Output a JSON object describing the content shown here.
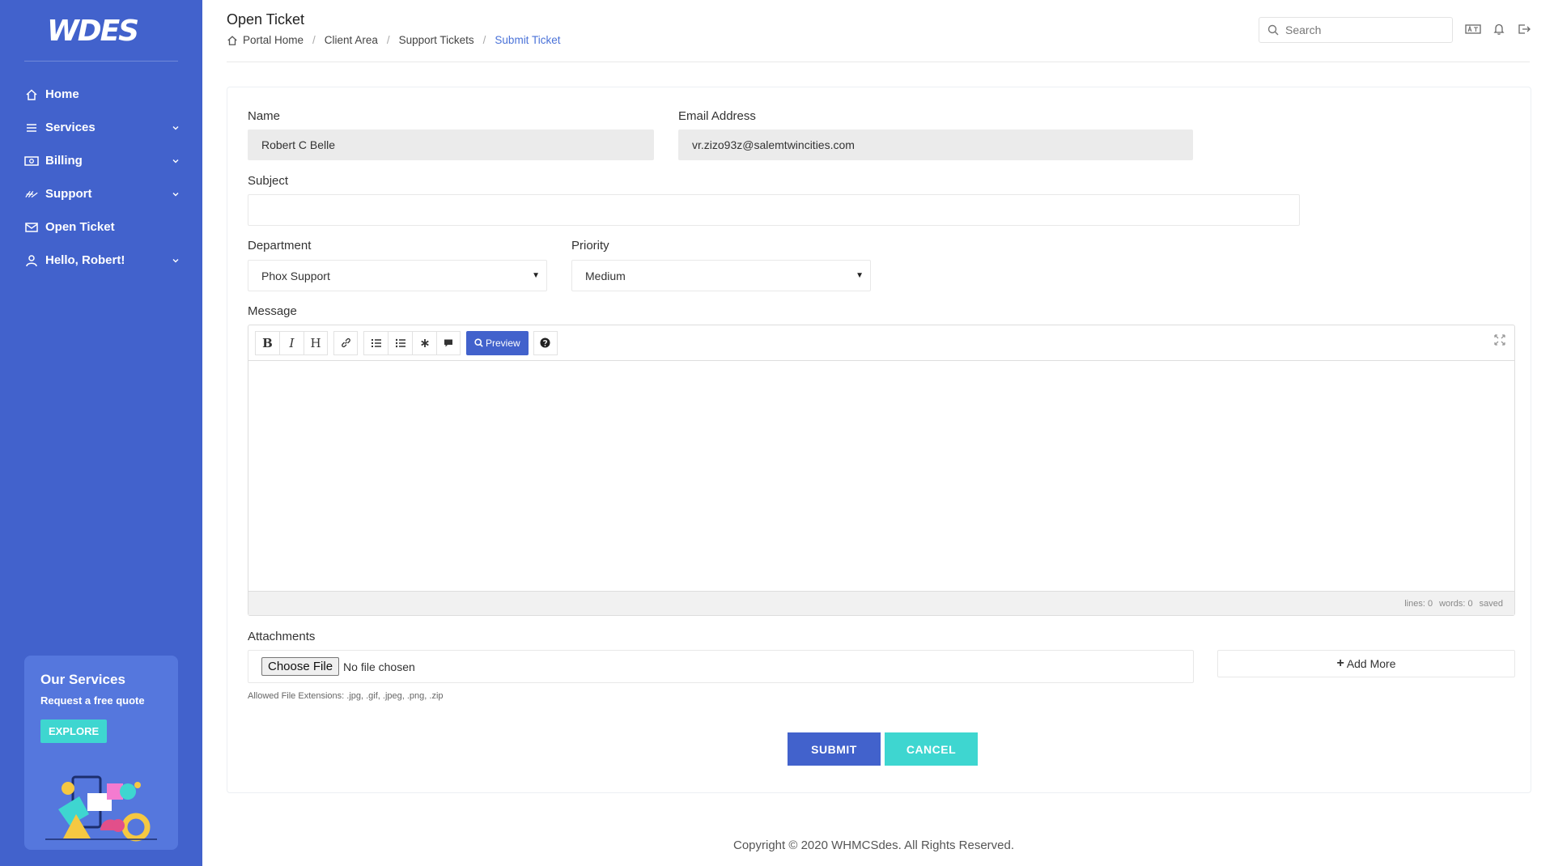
{
  "brand": {
    "logo_text": "WDES"
  },
  "sidebar": {
    "items": [
      {
        "label": "Home",
        "icon": "home-icon",
        "has_children": false
      },
      {
        "label": "Services",
        "icon": "menu-icon",
        "has_children": true
      },
      {
        "label": "Billing",
        "icon": "money-icon",
        "has_children": true
      },
      {
        "label": "Support",
        "icon": "support-icon",
        "has_children": true
      },
      {
        "label": "Open Ticket",
        "icon": "mail-icon",
        "has_children": false
      },
      {
        "label": "Hello, Robert!",
        "icon": "user-icon",
        "has_children": true
      }
    ],
    "promo": {
      "title": "Our Services",
      "subtitle": "Request a free quote",
      "button": "EXPLORE"
    }
  },
  "header": {
    "title": "Open Ticket",
    "breadcrumb": [
      "Portal Home",
      "Client Area",
      "Support Tickets",
      "Submit Ticket"
    ],
    "search_placeholder": "Search"
  },
  "form": {
    "name_label": "Name",
    "name_value": "Robert C Belle",
    "email_label": "Email Address",
    "email_value": "vr.zizo93z@salemtwincities.com",
    "subject_label": "Subject",
    "subject_value": "",
    "department_label": "Department",
    "department_value": "Phox Support",
    "priority_label": "Priority",
    "priority_value": "Medium",
    "message_label": "Message",
    "editor": {
      "toolbar": [
        "B",
        "I",
        "H"
      ],
      "preview_label": "Preview",
      "status": [
        "lines: 0",
        "words: 0",
        "saved"
      ]
    },
    "attachments_label": "Attachments",
    "choose_file_label": "Choose File",
    "no_file_label": "No file chosen",
    "add_more_label": "Add More",
    "allowed_extensions": "Allowed File Extensions: .jpg, .gif, .jpeg, .png, .zip",
    "submit_label": "SUBMIT",
    "cancel_label": "CANCEL"
  },
  "footer": {
    "copyright": "Copyright © 2020 WHMCSdes. All Rights Reserved."
  },
  "colors": {
    "sidebar": "#4262cc",
    "accent": "#3ed6d0",
    "link": "#4a72d8"
  }
}
